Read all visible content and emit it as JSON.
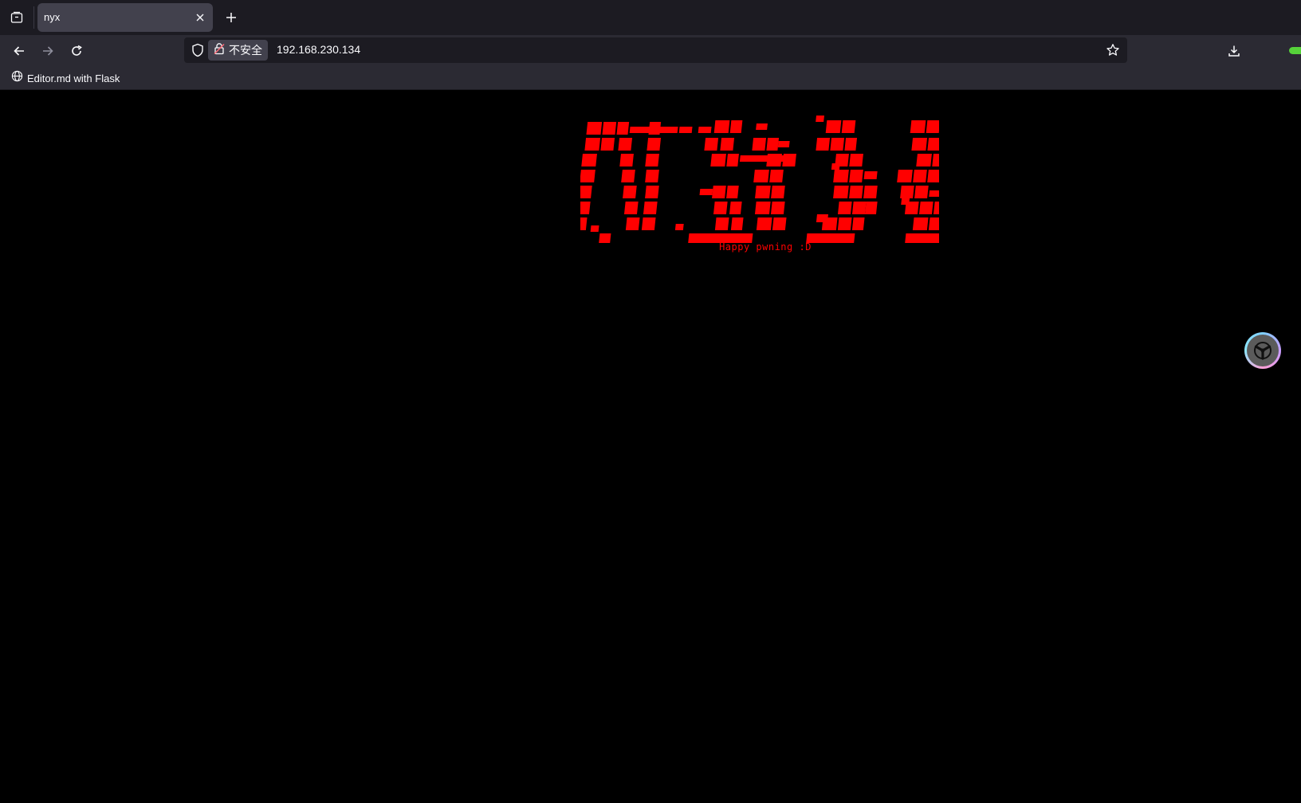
{
  "browser": {
    "tab": {
      "title": "nyx"
    },
    "security_label": "不安全",
    "url": "192.168.230.134",
    "bookmark": {
      "label": "Editor.md with Flask"
    }
  },
  "page": {
    "tagline": "Happy pwning :D",
    "banner_text": "NYX",
    "accent_color": "#ff0000"
  },
  "icons": {
    "tab_list": "tab-list-icon",
    "close": "close-icon",
    "new_tab": "plus-icon",
    "back": "back-arrow-icon",
    "forward": "forward-arrow-icon",
    "reload": "reload-icon",
    "shield": "shield-icon",
    "insecure_lock": "insecure-lock-icon",
    "bookmark_star": "star-icon",
    "downloads": "download-icon",
    "globe": "globe-icon",
    "floating_widget": "assistant-icon"
  }
}
